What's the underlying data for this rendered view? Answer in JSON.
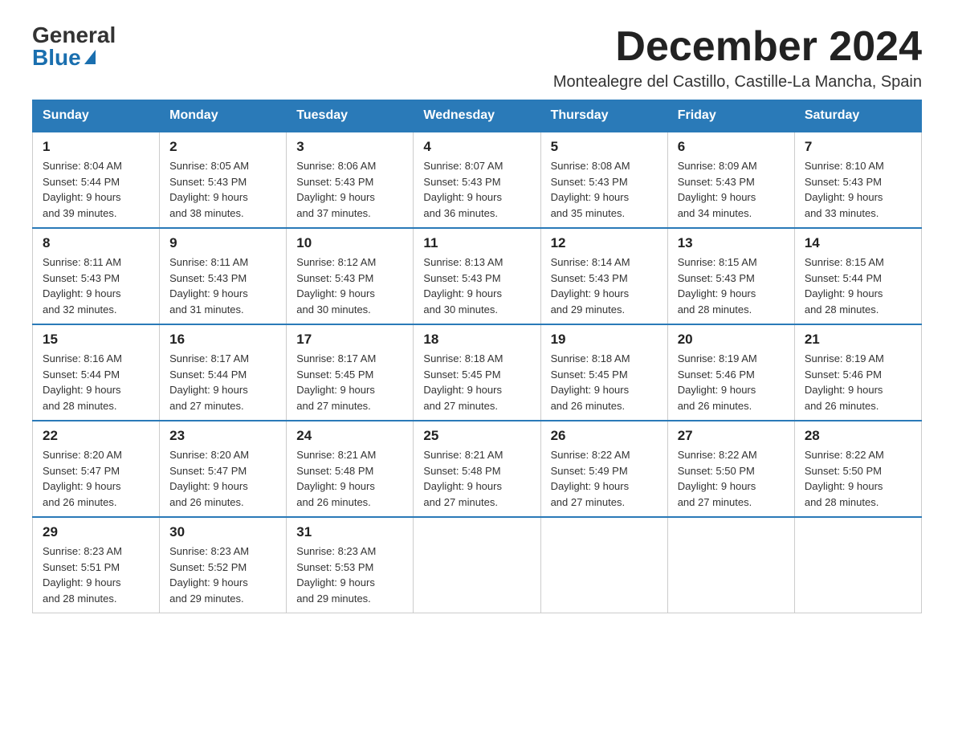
{
  "logo": {
    "general": "General",
    "blue": "Blue"
  },
  "header": {
    "month_title": "December 2024",
    "subtitle": "Montealegre del Castillo, Castille-La Mancha, Spain"
  },
  "days_of_week": [
    "Sunday",
    "Monday",
    "Tuesday",
    "Wednesday",
    "Thursday",
    "Friday",
    "Saturday"
  ],
  "weeks": [
    [
      {
        "day": "1",
        "sunrise": "8:04 AM",
        "sunset": "5:44 PM",
        "daylight": "9 hours and 39 minutes."
      },
      {
        "day": "2",
        "sunrise": "8:05 AM",
        "sunset": "5:43 PM",
        "daylight": "9 hours and 38 minutes."
      },
      {
        "day": "3",
        "sunrise": "8:06 AM",
        "sunset": "5:43 PM",
        "daylight": "9 hours and 37 minutes."
      },
      {
        "day": "4",
        "sunrise": "8:07 AM",
        "sunset": "5:43 PM",
        "daylight": "9 hours and 36 minutes."
      },
      {
        "day": "5",
        "sunrise": "8:08 AM",
        "sunset": "5:43 PM",
        "daylight": "9 hours and 35 minutes."
      },
      {
        "day": "6",
        "sunrise": "8:09 AM",
        "sunset": "5:43 PM",
        "daylight": "9 hours and 34 minutes."
      },
      {
        "day": "7",
        "sunrise": "8:10 AM",
        "sunset": "5:43 PM",
        "daylight": "9 hours and 33 minutes."
      }
    ],
    [
      {
        "day": "8",
        "sunrise": "8:11 AM",
        "sunset": "5:43 PM",
        "daylight": "9 hours and 32 minutes."
      },
      {
        "day": "9",
        "sunrise": "8:11 AM",
        "sunset": "5:43 PM",
        "daylight": "9 hours and 31 minutes."
      },
      {
        "day": "10",
        "sunrise": "8:12 AM",
        "sunset": "5:43 PM",
        "daylight": "9 hours and 30 minutes."
      },
      {
        "day": "11",
        "sunrise": "8:13 AM",
        "sunset": "5:43 PM",
        "daylight": "9 hours and 30 minutes."
      },
      {
        "day": "12",
        "sunrise": "8:14 AM",
        "sunset": "5:43 PM",
        "daylight": "9 hours and 29 minutes."
      },
      {
        "day": "13",
        "sunrise": "8:15 AM",
        "sunset": "5:43 PM",
        "daylight": "9 hours and 28 minutes."
      },
      {
        "day": "14",
        "sunrise": "8:15 AM",
        "sunset": "5:44 PM",
        "daylight": "9 hours and 28 minutes."
      }
    ],
    [
      {
        "day": "15",
        "sunrise": "8:16 AM",
        "sunset": "5:44 PM",
        "daylight": "9 hours and 28 minutes."
      },
      {
        "day": "16",
        "sunrise": "8:17 AM",
        "sunset": "5:44 PM",
        "daylight": "9 hours and 27 minutes."
      },
      {
        "day": "17",
        "sunrise": "8:17 AM",
        "sunset": "5:45 PM",
        "daylight": "9 hours and 27 minutes."
      },
      {
        "day": "18",
        "sunrise": "8:18 AM",
        "sunset": "5:45 PM",
        "daylight": "9 hours and 27 minutes."
      },
      {
        "day": "19",
        "sunrise": "8:18 AM",
        "sunset": "5:45 PM",
        "daylight": "9 hours and 26 minutes."
      },
      {
        "day": "20",
        "sunrise": "8:19 AM",
        "sunset": "5:46 PM",
        "daylight": "9 hours and 26 minutes."
      },
      {
        "day": "21",
        "sunrise": "8:19 AM",
        "sunset": "5:46 PM",
        "daylight": "9 hours and 26 minutes."
      }
    ],
    [
      {
        "day": "22",
        "sunrise": "8:20 AM",
        "sunset": "5:47 PM",
        "daylight": "9 hours and 26 minutes."
      },
      {
        "day": "23",
        "sunrise": "8:20 AM",
        "sunset": "5:47 PM",
        "daylight": "9 hours and 26 minutes."
      },
      {
        "day": "24",
        "sunrise": "8:21 AM",
        "sunset": "5:48 PM",
        "daylight": "9 hours and 26 minutes."
      },
      {
        "day": "25",
        "sunrise": "8:21 AM",
        "sunset": "5:48 PM",
        "daylight": "9 hours and 27 minutes."
      },
      {
        "day": "26",
        "sunrise": "8:22 AM",
        "sunset": "5:49 PM",
        "daylight": "9 hours and 27 minutes."
      },
      {
        "day": "27",
        "sunrise": "8:22 AM",
        "sunset": "5:50 PM",
        "daylight": "9 hours and 27 minutes."
      },
      {
        "day": "28",
        "sunrise": "8:22 AM",
        "sunset": "5:50 PM",
        "daylight": "9 hours and 28 minutes."
      }
    ],
    [
      {
        "day": "29",
        "sunrise": "8:23 AM",
        "sunset": "5:51 PM",
        "daylight": "9 hours and 28 minutes."
      },
      {
        "day": "30",
        "sunrise": "8:23 AM",
        "sunset": "5:52 PM",
        "daylight": "9 hours and 29 minutes."
      },
      {
        "day": "31",
        "sunrise": "8:23 AM",
        "sunset": "5:53 PM",
        "daylight": "9 hours and 29 minutes."
      },
      null,
      null,
      null,
      null
    ]
  ],
  "labels": {
    "sunrise": "Sunrise:",
    "sunset": "Sunset:",
    "daylight": "Daylight:"
  }
}
